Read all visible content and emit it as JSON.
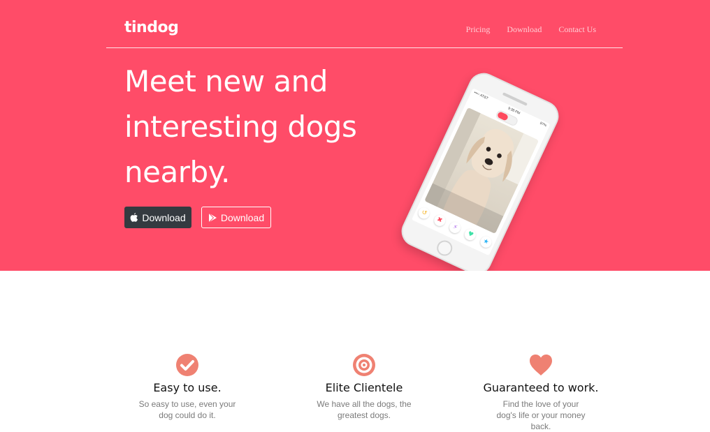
{
  "nav": {
    "brand": "tindog",
    "links": [
      "Pricing",
      "Download",
      "Contact Us"
    ]
  },
  "hero": {
    "headline": "Meet new and interesting dogs nearby.",
    "buttons": [
      {
        "label": "Download",
        "icon": "apple-icon"
      },
      {
        "label": "Download",
        "icon": "google-play-icon"
      }
    ]
  },
  "phone": {
    "carrier": "•••○ AT&T",
    "time": "9:38 PM",
    "battery": "97%",
    "actions": [
      "rewind-icon",
      "dislike-icon",
      "boost-icon",
      "like-icon",
      "superlike-icon"
    ]
  },
  "features": [
    {
      "icon": "check-circle-icon",
      "title": "Easy to use.",
      "text": "So easy to use, even your dog could do it."
    },
    {
      "icon": "bullseye-icon",
      "title": "Elite Clientele",
      "text": "We have all the dogs, the greatest dogs."
    },
    {
      "icon": "heart-icon",
      "title": "Guaranteed to work.",
      "text": "Find the love of your dog's life or your money back."
    }
  ],
  "colors": {
    "hero_background": "#ff4c68",
    "icon_accent": "#ef8172",
    "dark_button": "#343a40"
  }
}
